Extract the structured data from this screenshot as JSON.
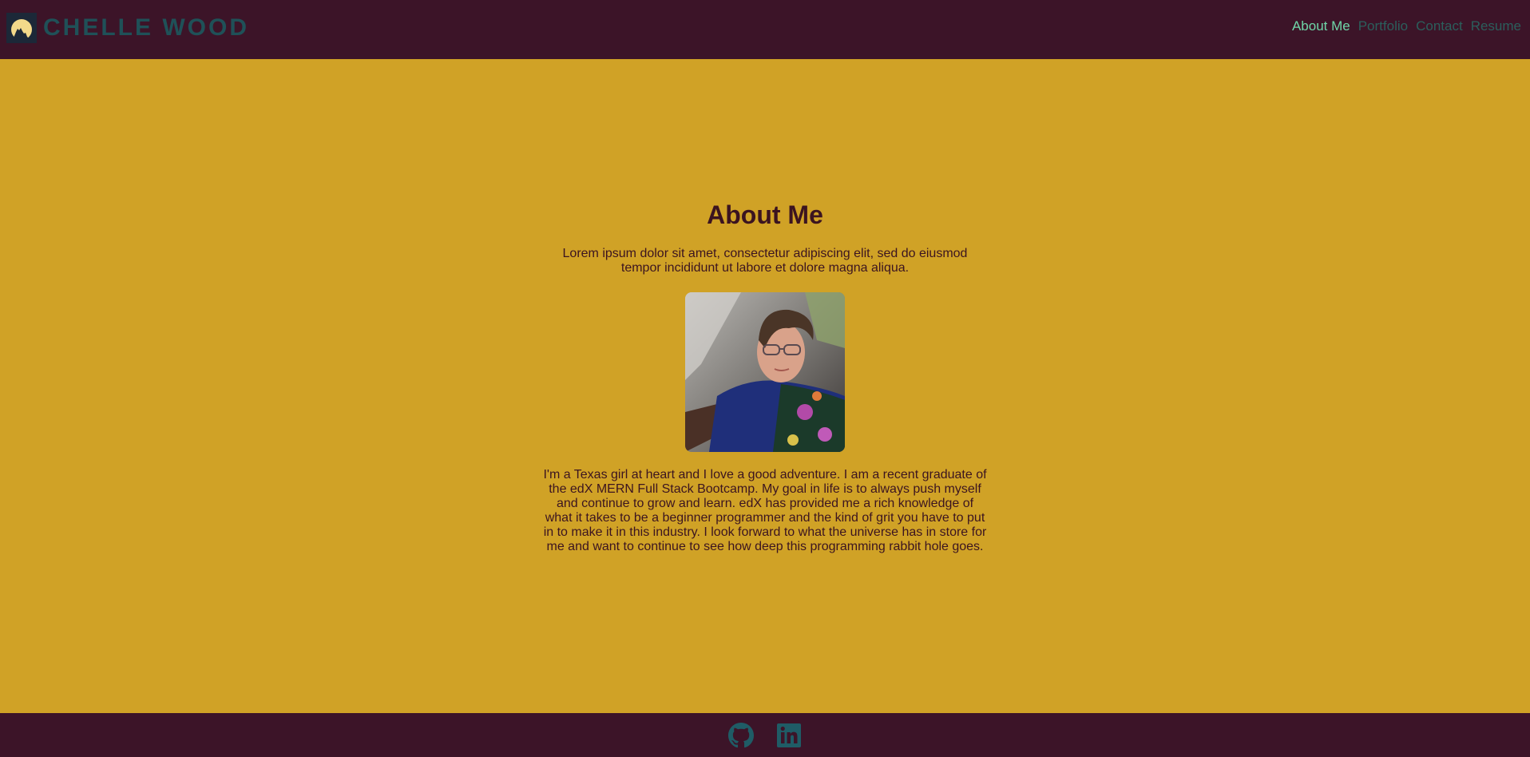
{
  "header": {
    "brand": "CHELLE WOOD",
    "logo_icon": "moon-howling-wolf-icon",
    "nav": [
      {
        "label": "About Me",
        "active": true
      },
      {
        "label": "Portfolio",
        "active": false
      },
      {
        "label": "Contact",
        "active": false
      },
      {
        "label": "Resume",
        "active": false
      }
    ]
  },
  "about": {
    "title": "About Me",
    "intro": "Lorem ipsum dolor sit amet, consectetur adipiscing elit, sed do eiusmod tempor incididunt ut labore et dolore magna aliqua.",
    "bio": "I'm a Texas girl at heart and I love a good adventure. I am a recent graduate of the edX MERN Full Stack Bootcamp. My goal in life is to always push myself and continue to grow and learn. edX has provided me a rich knowledge of what it takes to be a beginner programmer and the kind of grit you have to put in to make it in this industry. I look forward to what the universe has in store for me and want to continue to see how deep this programming rabbit hole goes."
  },
  "footer": {
    "icons": [
      "github-icon",
      "linkedin-icon"
    ]
  },
  "colors": {
    "header_bg": "#3c1428",
    "main_bg": "#d0a226",
    "brand": "#1f5158",
    "nav_active": "#6fd6a8",
    "nav_inactive": "#2b5f5c",
    "text": "#3b1420",
    "footer_icon": "#1f5c66"
  }
}
